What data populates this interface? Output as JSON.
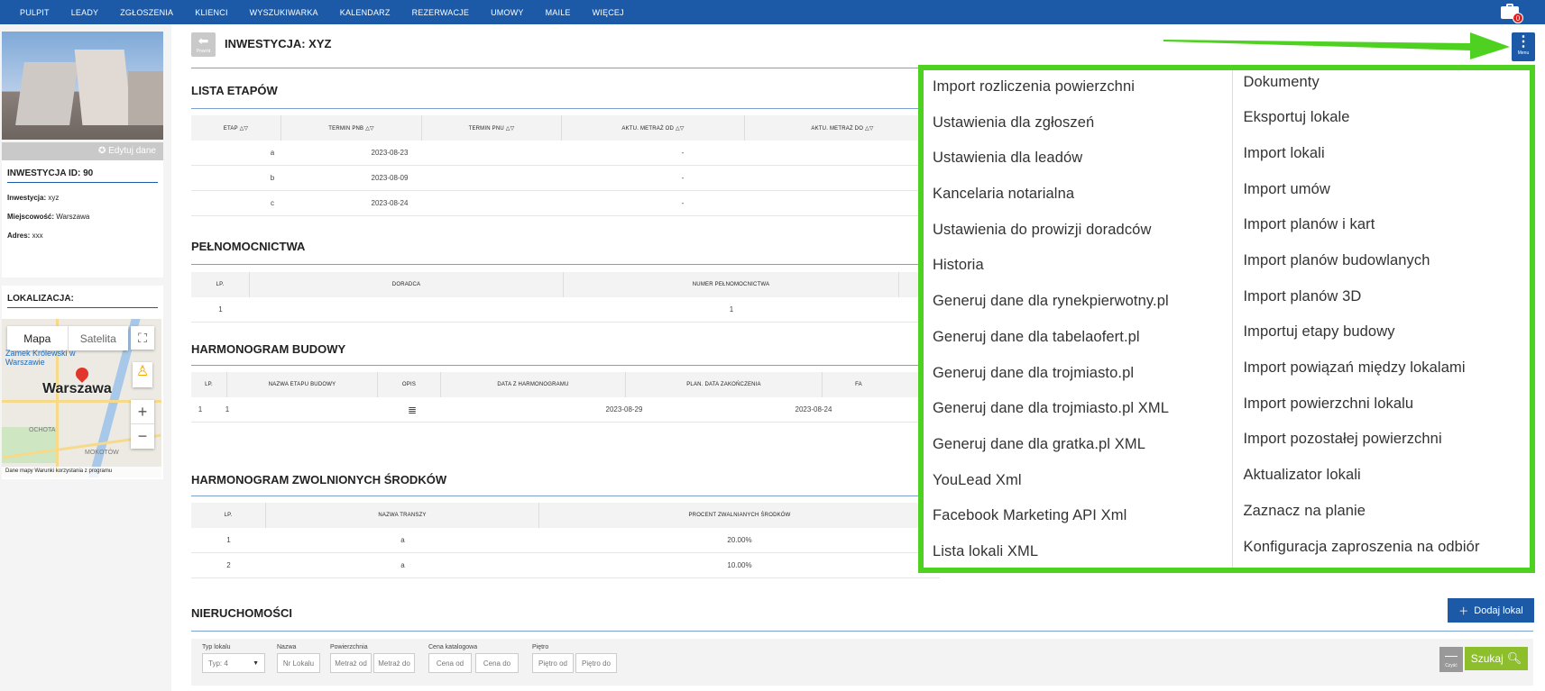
{
  "nav": {
    "items": [
      "PULPIT",
      "LEADY",
      "ZGŁOSZENIA",
      "KLIENCI",
      "WYSZUKIWARKA",
      "KALENDARZ",
      "REZERWACJE",
      "UMOWY",
      "MAILE",
      "WIĘCEJ"
    ],
    "badge": "0"
  },
  "sidebar": {
    "edit_label": "✪ Edytuj dane",
    "inv_title": "INWESTYCJA ID: 90",
    "inwestycja_label": "Inwestycja:",
    "inwestycja_value": "xyz",
    "miejscowosc_label": "Miejscowość:",
    "miejscowosc_value": "Warszawa",
    "adres_label": "Adres:",
    "adres_value": "xxx",
    "loc_title": "LOKALIZACJA:",
    "map": {
      "type_map": "Mapa",
      "type_sat": "Satelita",
      "city": "Warszawa",
      "poi": "Zamek Królewski w Warszawie",
      "district1": "OCHOTA",
      "district2": "MOKOTÓW",
      "credit": "Dane mapy   Warunki korzystania z programu",
      "fullscreen_icon": "⛶",
      "pegman_icon": "♙",
      "zoom_in": "+",
      "zoom_out": "−"
    }
  },
  "header": {
    "back_label": "Powrót",
    "title": "INWESTYCJA: XYZ",
    "menu_label": "Menu"
  },
  "etapy": {
    "title": "LISTA ETAPÓW",
    "columns": [
      "ETAP △▽",
      "TERMIN PNB △▽",
      "TERMIN PNU △▽",
      "AKTU. METRAŻ OD △▽",
      "AKTU. METRAŻ DO △▽"
    ],
    "rows": [
      [
        "a",
        "2023-08-23",
        "",
        "-",
        ""
      ],
      [
        "b",
        "2023-08-09",
        "",
        "-",
        ""
      ],
      [
        "c",
        "2023-08-24",
        "",
        "-",
        ""
      ]
    ]
  },
  "pelnomocnictwa": {
    "title": "PEŁNOMOCNICTWA",
    "columns": [
      "LP.",
      "DORADCA",
      "NUMER PEŁNOMOCNICTWA"
    ],
    "rows": [
      [
        "1",
        "",
        "1"
      ]
    ]
  },
  "harmonogram": {
    "title": "HARMONOGRAM BUDOWY",
    "columns": [
      "LP.",
      "NAZWA ETAPU BUDOWY",
      "OPIS",
      "DATA Z HARMONOGRAMU",
      "PLAN. DATA ZAKOŃCZENIA",
      "FA"
    ],
    "rows": [
      [
        "1",
        "1",
        "≣",
        "2023-08-29",
        "2023-08-24",
        ""
      ]
    ]
  },
  "srodki": {
    "title": "HARMONOGRAM ZWOLNIONYCH ŚRODKÓW",
    "columns": [
      "LP.",
      "NAZWA TRANSZY",
      "PROCENT ZWALNIANYCH ŚRODKÓW"
    ],
    "rows": [
      [
        "1",
        "a",
        "20.00%"
      ],
      [
        "2",
        "a",
        "10.00%"
      ]
    ]
  },
  "nieruchomosci": {
    "title": "NIERUCHOMOŚCI",
    "add_label": "Dodaj lokal",
    "filters": [
      {
        "label": "Typ lokalu",
        "inputs": [
          "Typ: 4"
        ]
      },
      {
        "label": "Nazwa",
        "inputs": [
          "Nr Lokalu"
        ]
      },
      {
        "label": "Powierzchnia",
        "inputs": [
          "Metraż od",
          "Metraż do"
        ]
      },
      {
        "label": "Cena katalogowa",
        "inputs": [
          "Cena od",
          "Cena do"
        ]
      },
      {
        "label": "Piętro",
        "inputs": [
          "Piętro od",
          "Piętro do"
        ]
      }
    ],
    "clear_label": "Czyść",
    "search_label": "Szukaj"
  },
  "menu": {
    "col1": [
      "Import rozliczenia powierzchni",
      "Ustawienia dla zgłoszeń",
      "Ustawienia dla leadów",
      "Kancelaria notarialna",
      "Ustawienia do prowizji doradców",
      "Historia",
      "Generuj dane dla rynekpierwotny.pl",
      "Generuj dane dla tabelaofert.pl",
      "Generuj dane dla trojmiasto.pl",
      "Generuj dane dla trojmiasto.pl XML",
      "Generuj dane dla gratka.pl XML",
      "YouLead Xml",
      "Facebook Marketing API Xml",
      "Lista lokali XML"
    ],
    "col2": [
      "Dokumenty",
      "Eksportuj lokale",
      "Import lokali",
      "Import umów",
      "Import planów i kart",
      "Import planów budowlanych",
      "Import planów 3D",
      "Importuj etapy budowy",
      "Import powiązań między lokalami",
      "Import powierzchni lokalu",
      "Import pozostałej powierzchni",
      "Aktualizator lokali",
      "Zaznacz na planie",
      "Konfiguracja zaproszenia na odbiór"
    ]
  },
  "colors": {
    "nav": "#1c5aa8",
    "highlight": "#4fd121",
    "search": "#8cbf2b"
  }
}
